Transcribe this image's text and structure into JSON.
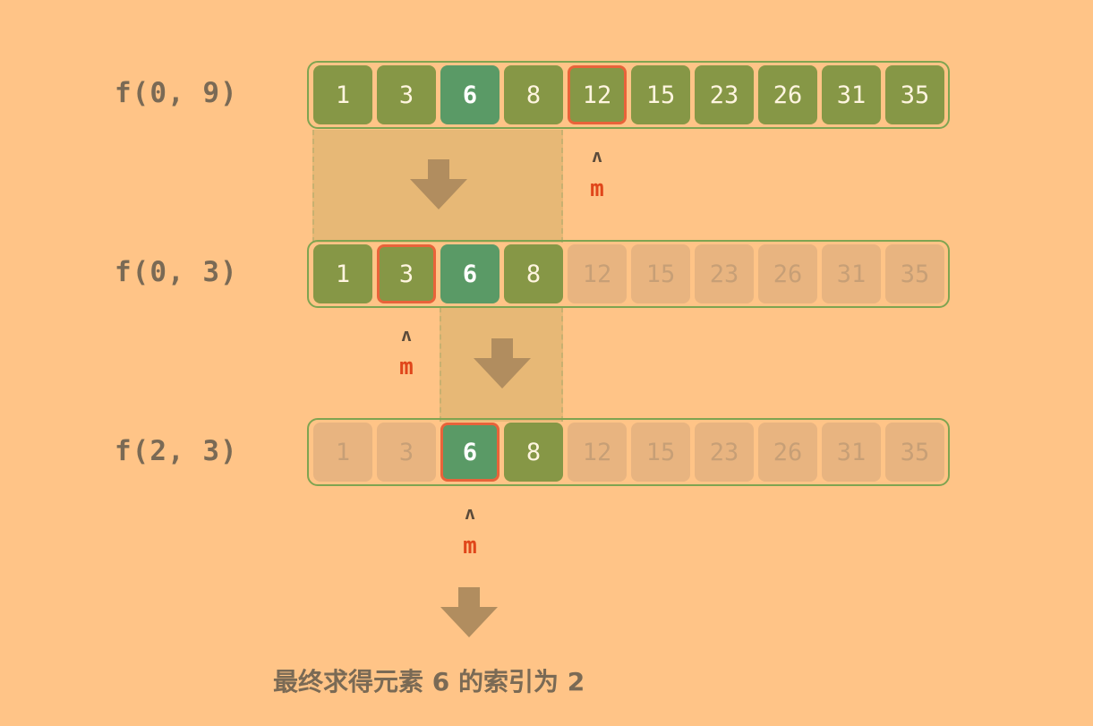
{
  "array": [
    1,
    3,
    6,
    8,
    12,
    15,
    23,
    26,
    31,
    35
  ],
  "colors": {
    "background": "#FFC487",
    "active_cell": "#869746",
    "target_cell": "#5A9A66",
    "inactive_cell": "#E8B480",
    "mid_border": "#E8633A",
    "pointer_label": "#E0461A",
    "arrow": "#B18D5F"
  },
  "steps": [
    {
      "label": "f(0, 9)",
      "i": 0,
      "j": 9,
      "mid": 4,
      "pointer_label": "m"
    },
    {
      "label": "f(0, 3)",
      "i": 0,
      "j": 3,
      "mid": 1,
      "pointer_label": "m"
    },
    {
      "label": "f(2, 3)",
      "i": 2,
      "j": 3,
      "mid": 2,
      "pointer_label": "m"
    }
  ],
  "target_index": 2,
  "result_text": "最终求得元素 6 的索引为 2"
}
